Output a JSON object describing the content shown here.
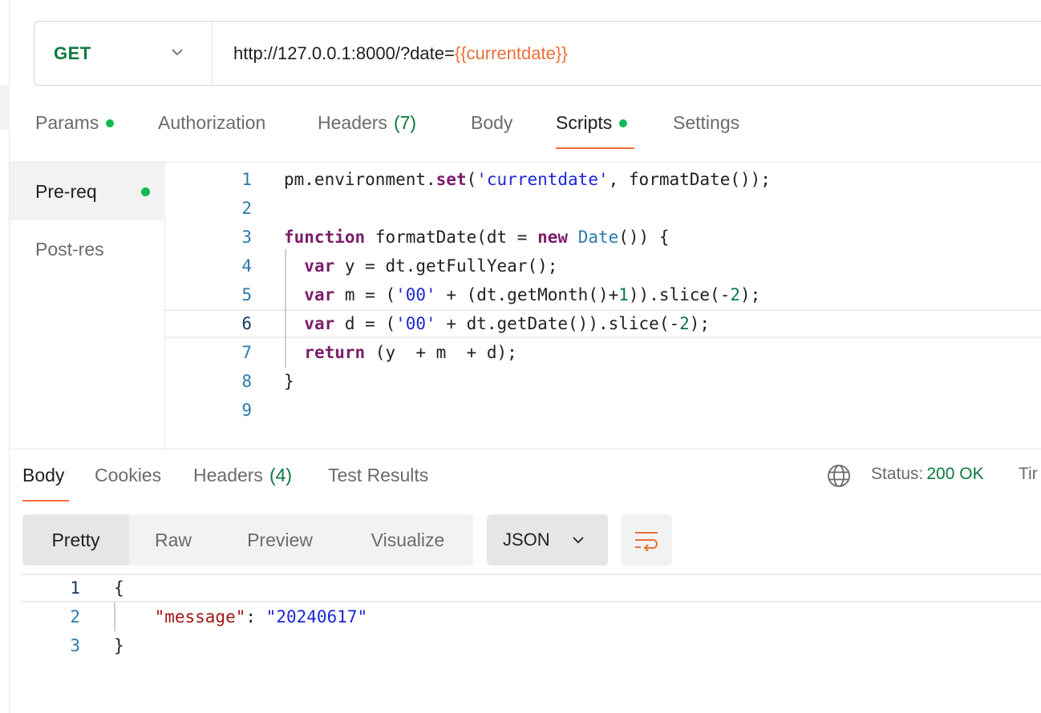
{
  "request": {
    "method": "GET",
    "url_prefix": "http://127.0.0.1:8000/?date=",
    "url_variable": "{{currentdate}}"
  },
  "request_tabs": [
    {
      "label": "Params",
      "dot": true,
      "count": ""
    },
    {
      "label": "Authorization",
      "dot": false,
      "count": ""
    },
    {
      "label": "Headers",
      "dot": false,
      "count": "(7)"
    },
    {
      "label": "Body",
      "dot": false,
      "count": ""
    },
    {
      "label": "Scripts",
      "dot": true,
      "count": "",
      "active": true
    },
    {
      "label": "Settings",
      "dot": false,
      "count": ""
    }
  ],
  "script_tabs": [
    {
      "label": "Pre-req",
      "active": true,
      "dot": true
    },
    {
      "label": "Post-res",
      "active": false,
      "dot": false
    }
  ],
  "editor": {
    "current_line": 6,
    "lines": [
      [
        [
          "t",
          "pm.environment."
        ],
        [
          "fn",
          "set"
        ],
        [
          "t",
          "("
        ],
        [
          "str",
          "'currentdate'"
        ],
        [
          "t",
          ", formatDate());"
        ]
      ],
      [],
      [
        [
          "kw",
          "function"
        ],
        [
          "t",
          " formatDate(dt = "
        ],
        [
          "kw",
          "new"
        ],
        [
          "t",
          " "
        ],
        [
          "typ",
          "Date"
        ],
        [
          "t",
          "()) {"
        ]
      ],
      [
        [
          "t",
          "  "
        ],
        [
          "kw",
          "var"
        ],
        [
          "t",
          " y = dt.getFullYear();"
        ]
      ],
      [
        [
          "t",
          "  "
        ],
        [
          "kw",
          "var"
        ],
        [
          "t",
          " m = ("
        ],
        [
          "str",
          "'00'"
        ],
        [
          "t",
          " + (dt.getMonth()+"
        ],
        [
          "num",
          "1"
        ],
        [
          "t",
          ")).slice(-"
        ],
        [
          "num",
          "2"
        ],
        [
          "t",
          ");"
        ]
      ],
      [
        [
          "t",
          "  "
        ],
        [
          "kw",
          "var"
        ],
        [
          "t",
          " d = ("
        ],
        [
          "str",
          "'00'"
        ],
        [
          "t",
          " + dt.getDate()).slice(-"
        ],
        [
          "num",
          "2"
        ],
        [
          "t",
          ");"
        ]
      ],
      [
        [
          "t",
          "  "
        ],
        [
          "kw",
          "return"
        ],
        [
          "t",
          " (y  + m  + d);"
        ]
      ],
      [
        [
          "t",
          "}"
        ]
      ],
      []
    ]
  },
  "response_tabs": [
    {
      "label": "Body",
      "count": "",
      "active": true
    },
    {
      "label": "Cookies",
      "count": ""
    },
    {
      "label": "Headers",
      "count": "(4)"
    },
    {
      "label": "Test Results",
      "count": ""
    }
  ],
  "response_meta": {
    "globe_icon": "globe-icon",
    "status_label": "Status:",
    "status_value": "200 OK",
    "time_label": "Tir"
  },
  "view_modes": [
    {
      "label": "Pretty",
      "active": true
    },
    {
      "label": "Raw"
    },
    {
      "label": "Preview"
    },
    {
      "label": "Visualize"
    }
  ],
  "format_select": {
    "value": "JSON"
  },
  "response_body": {
    "current_line": 1,
    "lines": [
      [
        [
          "t",
          "{"
        ]
      ],
      [
        [
          "t",
          "    "
        ],
        [
          "jkey",
          "\"message\""
        ],
        [
          "t",
          ": "
        ],
        [
          "jstr",
          "\"20240617\""
        ]
      ],
      [
        [
          "t",
          "}"
        ]
      ]
    ]
  },
  "colors": {
    "accent": "#ff6c37",
    "method_green": "#0b7a3e",
    "dot_green": "#0cbb52",
    "variable_orange": "#e8703a"
  }
}
